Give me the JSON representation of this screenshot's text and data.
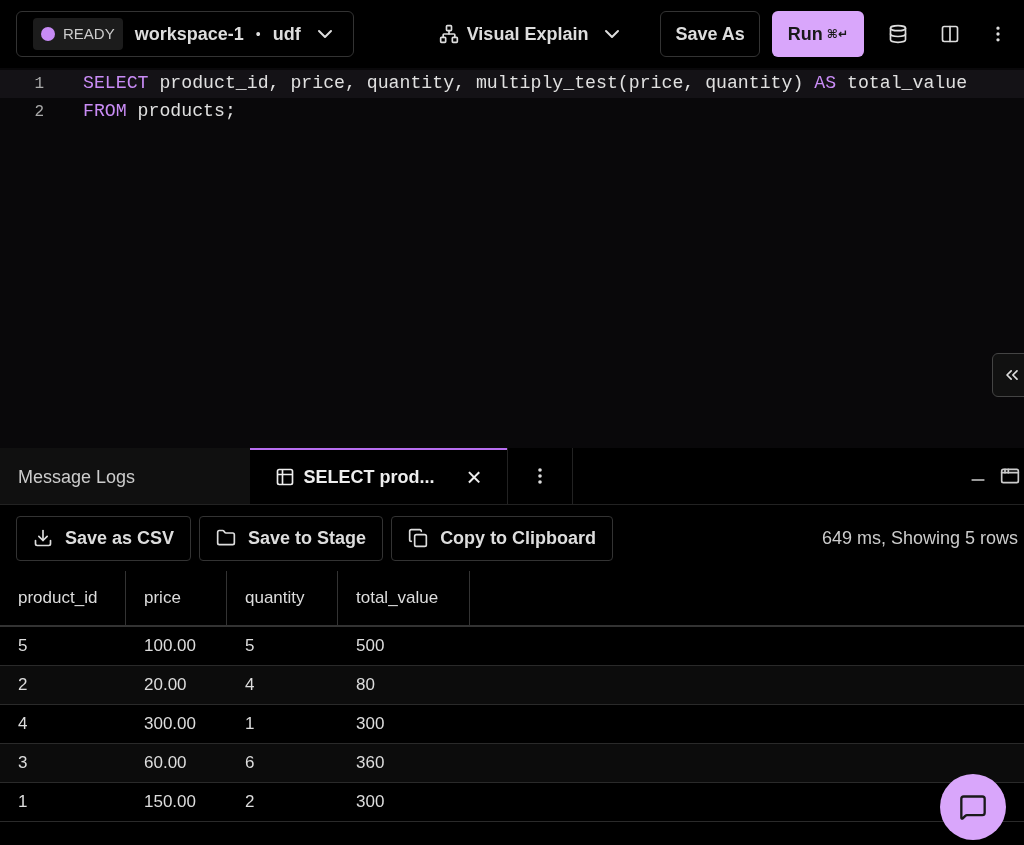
{
  "top_bar": {
    "status": {
      "label": "READY",
      "color": "#c78bf5"
    },
    "workspace": "workspace-1",
    "database": "udf",
    "separator": "•",
    "explain": "Visual Explain",
    "buttons": [
      {
        "label": "Save As",
        "kind": "secondary"
      },
      {
        "label": "Run",
        "shortcut": "⌘↵",
        "kind": "primary"
      }
    ]
  },
  "editor": {
    "lines": [
      {
        "number": "1",
        "tokens": [
          {
            "text": "SELECT",
            "kind": "keyword"
          },
          {
            "text": " product_id, price, quantity, multiply_test(price, quantity) ",
            "kind": "plain"
          },
          {
            "text": "AS",
            "kind": "keyword"
          },
          {
            "text": " total_value",
            "kind": "plain"
          }
        ]
      },
      {
        "number": "2",
        "tokens": [
          {
            "text": "FROM",
            "kind": "keyword"
          },
          {
            "text": " products;",
            "kind": "plain"
          }
        ]
      }
    ]
  },
  "results": {
    "tabs": [
      {
        "label": "Message Logs",
        "selected": false,
        "kind": "logs"
      },
      {
        "label": "SELECT prod...",
        "selected": true,
        "kind": "result",
        "close": "×"
      }
    ],
    "actions": [
      {
        "label": "Save as CSV",
        "kind": "download"
      },
      {
        "label": "Save to Stage",
        "kind": "folder"
      },
      {
        "label": "Copy to Clipboard",
        "kind": "copy"
      }
    ],
    "summary": "649 ms, Showing 5 rows",
    "table": {
      "columns": [
        "product_id",
        "price",
        "quantity",
        "total_value"
      ],
      "rows": [
        [
          "5",
          "100.00",
          "5",
          "500"
        ],
        [
          "2",
          "20.00",
          "4",
          "80"
        ],
        [
          "4",
          "300.00",
          "1",
          "300"
        ],
        [
          "3",
          "60.00",
          "6",
          "360"
        ],
        [
          "1",
          "150.00",
          "2",
          "300"
        ]
      ]
    }
  }
}
